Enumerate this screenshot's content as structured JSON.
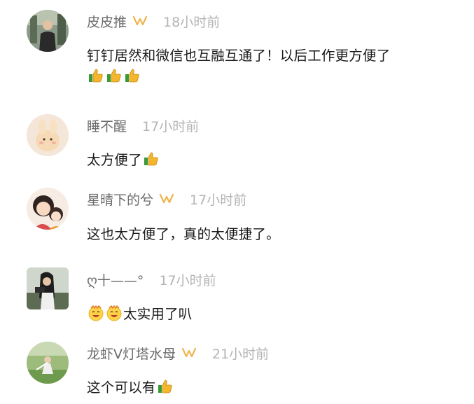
{
  "comments": [
    {
      "user": "皮皮推",
      "verified": true,
      "time": "18小时前",
      "text": "钉钉居然和微信也互融互通了！以后工作更方便了",
      "emojis": [
        "thumbs-up-icon",
        "thumbs-up-icon",
        "thumbs-up-icon"
      ]
    },
    {
      "user": "睡不醒",
      "verified": false,
      "time": "17小时前",
      "text": "太方便了",
      "emojis": [
        "thumbs-up-icon"
      ]
    },
    {
      "user": "星晴下的兮",
      "verified": true,
      "time": "17小时前",
      "text": "这也太方便了，真的太便捷了。",
      "emojis": []
    },
    {
      "user": "ღ十——°",
      "verified": false,
      "time": "17小时前",
      "text": "太实用了叭",
      "emojis": [
        "smiley-face-icon",
        "smiley-face-icon"
      ]
    },
    {
      "user": "龙虾V灯塔水母",
      "verified": true,
      "time": "21小时前",
      "text": "这个可以有",
      "emojis": [
        "thumbs-up-icon"
      ]
    }
  ],
  "colors": {
    "username": "#6b6b6b",
    "timestamp": "#b4b4b4",
    "text": "#1a1a1a",
    "verified_badge": "#f0b44c"
  }
}
